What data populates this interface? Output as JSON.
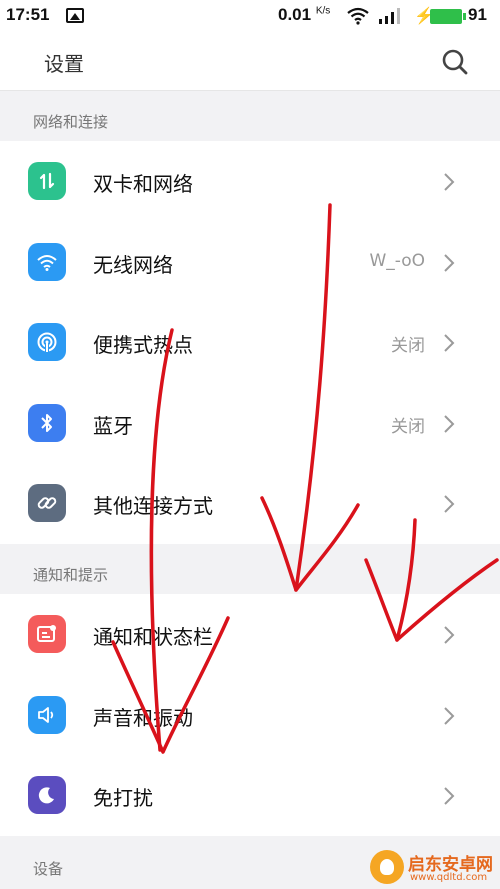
{
  "status_bar": {
    "time": "17:51",
    "network_speed": "0.01",
    "network_speed_unit": "K/s",
    "battery_level": "91",
    "icons": [
      "image-icon",
      "wifi-icon",
      "signal-icon",
      "charging-icon",
      "battery-icon"
    ],
    "battery_color": "#2fbf4a"
  },
  "app_bar": {
    "title": "设置",
    "search_icon": "search-icon"
  },
  "sections": [
    {
      "header": "网络和连接",
      "items": [
        {
          "label": "双卡和网络",
          "value": "",
          "icon": "data-transfer-icon",
          "color": "#2cc28e"
        },
        {
          "label": "无线网络",
          "value": "W_-oO",
          "icon": "wifi-icon",
          "color": "#2b9af3"
        },
        {
          "label": "便携式热点",
          "value": "关闭",
          "icon": "hotspot-icon",
          "color": "#2b9af3"
        },
        {
          "label": "蓝牙",
          "value": "关闭",
          "icon": "bluetooth-icon",
          "color": "#3d7ef0"
        },
        {
          "label": "其他连接方式",
          "value": "",
          "icon": "link-icon",
          "color": "#5d6c80"
        }
      ]
    },
    {
      "header": "通知和提示",
      "items": [
        {
          "label": "通知和状态栏",
          "value": "",
          "icon": "notification-icon",
          "color": "#f45b5b"
        },
        {
          "label": "声音和振动",
          "value": "",
          "icon": "volume-icon",
          "color": "#2b9af3"
        },
        {
          "label": "免打扰",
          "value": "",
          "icon": "moon-icon",
          "color": "#5b4dbf"
        }
      ]
    },
    {
      "header": "设备",
      "items": []
    }
  ],
  "watermark": {
    "name": "启东安卓网",
    "url": "www.qdltd.com"
  },
  "annotation_color": "#d9121b"
}
